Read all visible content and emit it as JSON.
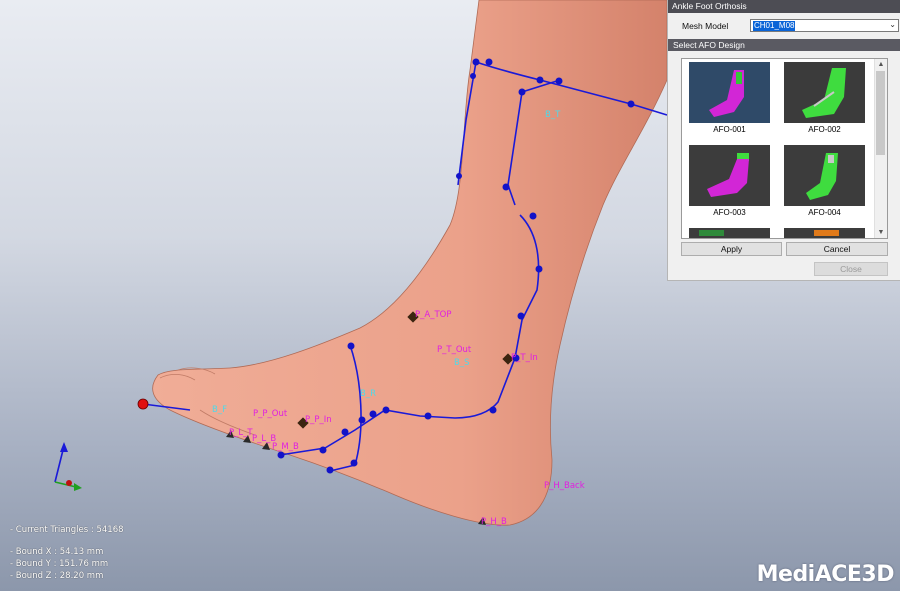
{
  "dialog": {
    "title": "Ankle Foot Orthosis",
    "mesh_model_label": "Mesh Model",
    "mesh_model_value": "CH01_M08",
    "select_design_label": "Select AFO Design",
    "designs": [
      {
        "label": "AFO-001",
        "bg": "#2f4a68",
        "color": "#d226d6",
        "accent": "#36c63a"
      },
      {
        "label": "AFO-002",
        "bg": "#3b3b3b",
        "color": "#3fdc3f",
        "accent": "#c8c8c8"
      },
      {
        "label": "AFO-003",
        "bg": "#3c3c3c",
        "color": "#d226d6",
        "accent": "#3fdc3f"
      },
      {
        "label": "AFO-004",
        "bg": "#3c3c3c",
        "color": "#3fdc3f",
        "accent": "#c8c8c8"
      }
    ],
    "apply_label": "Apply",
    "cancel_label": "Cancel",
    "close_label": "Close"
  },
  "landmarks": [
    "P_A_TOP",
    "P_T_Out",
    "P_T_In",
    "P_P_Out",
    "P_P_In",
    "P_H_Back",
    "P_H_B",
    "P_M_B",
    "P_L_B",
    "P_L_T"
  ],
  "guides": [
    "B_T",
    "B_S",
    "B_F",
    "B_R"
  ],
  "stats": {
    "triangles": "- Current Triangles : 54168",
    "bound_x": "- Bound X : 54.13 mm",
    "bound_y": "- Bound Y : 151.76 mm",
    "bound_z": "- Bound Z : 28.20 mm"
  },
  "brand": "MediACE3D",
  "colors": {
    "curve": "#1a1ad8",
    "skin": "#eda08c",
    "landmark_text": "#e020e0",
    "guide_text": "#4fd9e8"
  }
}
